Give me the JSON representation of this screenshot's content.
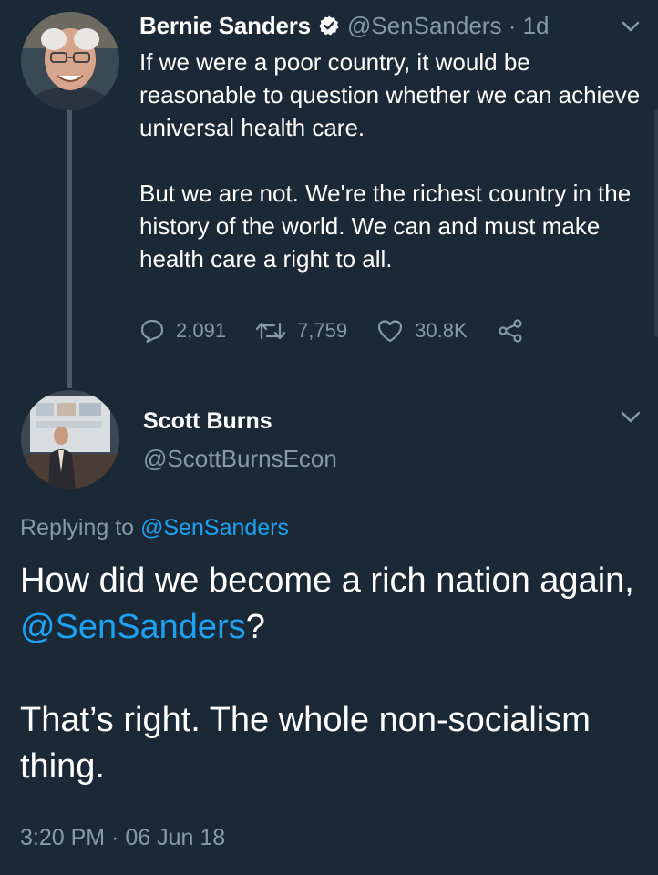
{
  "original_tweet": {
    "author_name": "Bernie Sanders",
    "handle": "@SenSanders",
    "separator": "·",
    "age": "1d",
    "paragraph_1": "If we were a poor country, it would be reasonable to question whether we can achieve universal health care.",
    "paragraph_2": "But we are not. We're the richest country in the history of the world. We can and must make health care a right to all.",
    "replies_count": "2,091",
    "retweets_count": "7,759",
    "likes_count": "30.8K"
  },
  "reply_tweet": {
    "author_name": "Scott Burns",
    "handle": "@ScottBurnsEcon",
    "replying_prefix": "Replying to",
    "replying_to": "@SenSanders",
    "line_1_pre": "How did we become a rich nation again, ",
    "line_1_mention": "@SenSanders",
    "line_1_post": "?",
    "paragraph_2": "That’s right. The whole non-socialism thing.",
    "timestamp": "3:20 PM · 06 Jun 18"
  },
  "colors": {
    "background": "#1b2836",
    "text": "#ffffff",
    "muted": "#8899a6",
    "link": "#1da1f2",
    "thread_line": "#4b5a68"
  },
  "icons": [
    "verified-badge-icon",
    "chevron-down-icon",
    "reply-icon",
    "retweet-icon",
    "like-icon",
    "share-icon"
  ]
}
